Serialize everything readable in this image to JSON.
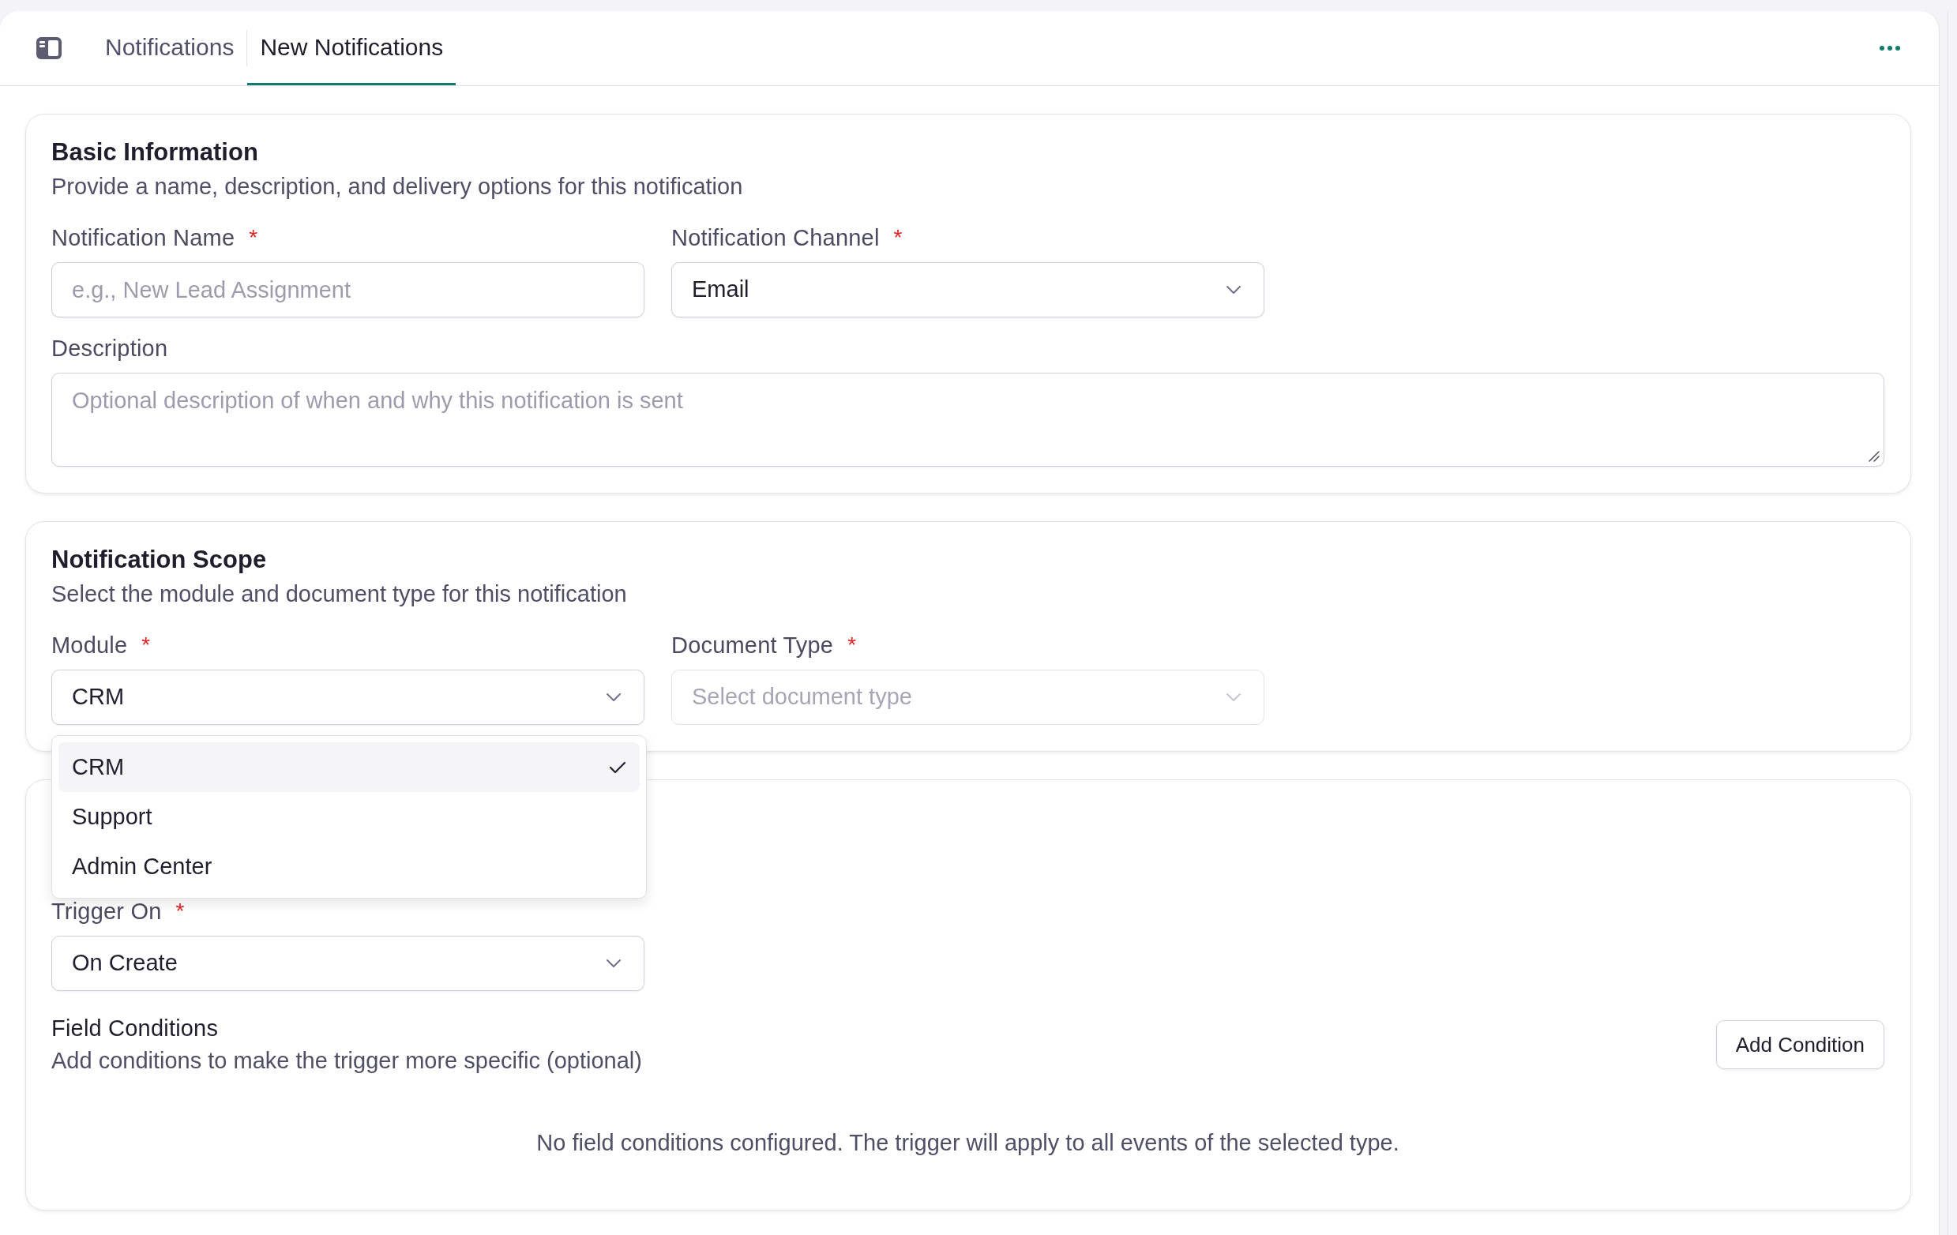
{
  "tab_bar": {
    "tabs": [
      {
        "label": "Notifications",
        "selected": false
      },
      {
        "label": "New Notifications",
        "selected": true
      }
    ]
  },
  "sections": [
    {
      "title": "Basic Information",
      "subtitle": "Provide a name, description, and delivery options for this notification",
      "fields": [
        {
          "kind": "input",
          "label": "Notification Name",
          "required_mark": "*",
          "placeholder": "e.g., New Lead Assignment",
          "disabled": false
        },
        {
          "kind": "select",
          "label": "Notification Channel",
          "required_mark": "*",
          "value": "Email",
          "disabled": false
        },
        {
          "kind": "textarea",
          "label": "Description",
          "placeholder": "Optional description of when and why this notification is sent",
          "disabled": false
        }
      ]
    },
    {
      "title": "Notification Scope",
      "subtitle": "Select the module and document type for this notification",
      "fields": [
        {
          "kind": "select",
          "label": "Module",
          "required_mark": "*",
          "value": "CRM",
          "disabled": false,
          "options": [
            {
              "label": "CRM",
              "selected": true
            },
            {
              "label": "Support",
              "selected": false
            },
            {
              "label": "Admin Center",
              "selected": false
            }
          ]
        },
        {
          "kind": "select",
          "label": "Document Type",
          "required_mark": "*",
          "placeholder": "Select document type",
          "disabled": true
        }
      ]
    },
    {
      "fields": [
        {
          "kind": "select",
          "label": "Trigger On",
          "required_mark": "*",
          "value": "On Create",
          "disabled": false
        }
      ],
      "conditions": {
        "title": "Field Conditions",
        "subtitle": "Add conditions to make the trigger more specific (optional)",
        "button": "Add Condition",
        "empty_message": "No field conditions configured. The trigger will apply to all events of the selected type."
      }
    }
  ]
}
